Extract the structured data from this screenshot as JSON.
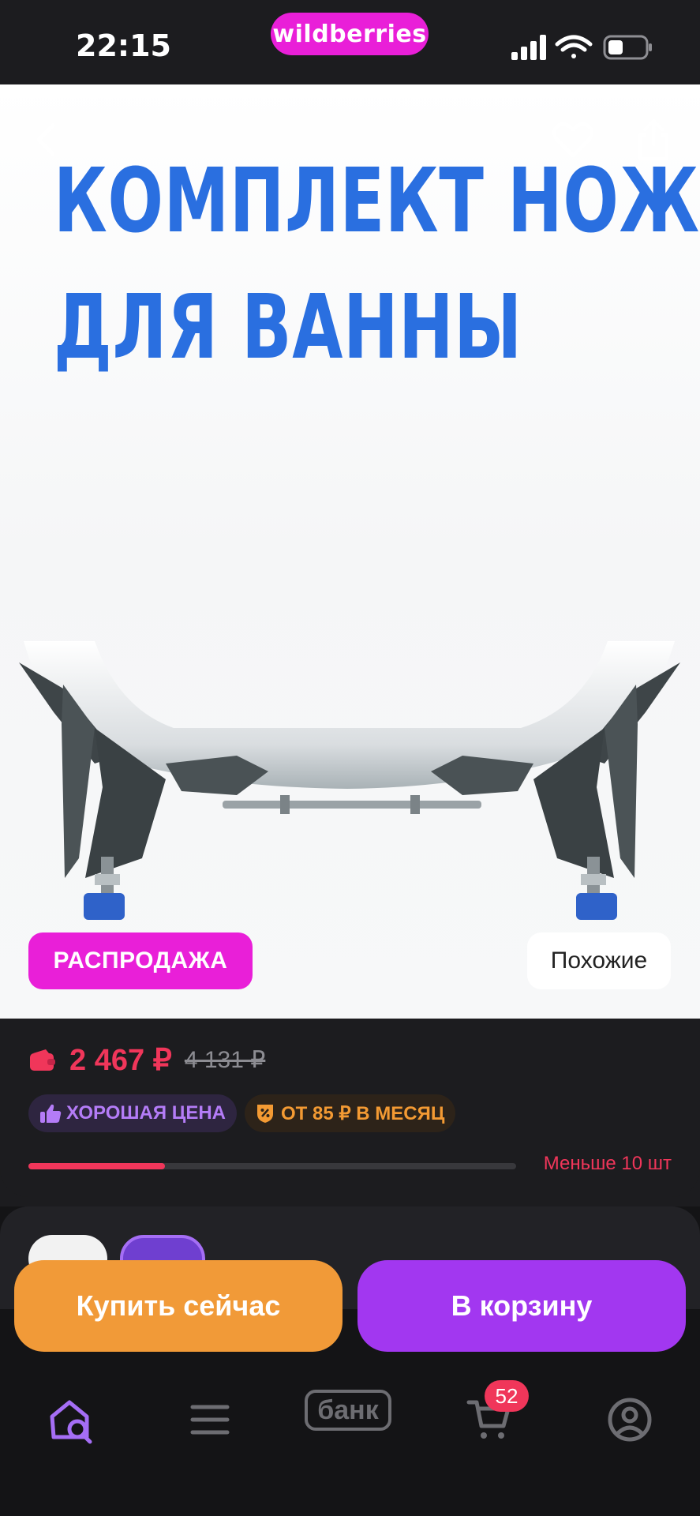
{
  "status_bar": {
    "time": "22:15",
    "brand": "wildberries"
  },
  "hero": {
    "title_line1": "КОМПЛЕКТ НОЖЕК",
    "title_line2": "ДЛЯ ВАННЫ",
    "sale_label": "РАСПРОДАЖА",
    "similar_label": "Похожие"
  },
  "price": {
    "current": "2 467 ₽",
    "old": "4 131 ₽",
    "chip_good_price": "ХОРОШАЯ ЦЕНА",
    "chip_installment": "ОТ 85 ₽ В МЕСЯЦ",
    "stock_text": "Меньше 10 шт",
    "stock_level": 0.28
  },
  "actions": {
    "buy_now": "Купить сейчас",
    "add_to_cart": "В корзину"
  },
  "tabbar": {
    "bank_label": "банк",
    "cart_count": "52"
  },
  "colors": {
    "accent_pink": "#e91fd8",
    "price_red": "#f0365a",
    "buy_orange": "#f19a38",
    "cart_purple": "#a237f0",
    "title_blue": "#2a6fe0"
  }
}
